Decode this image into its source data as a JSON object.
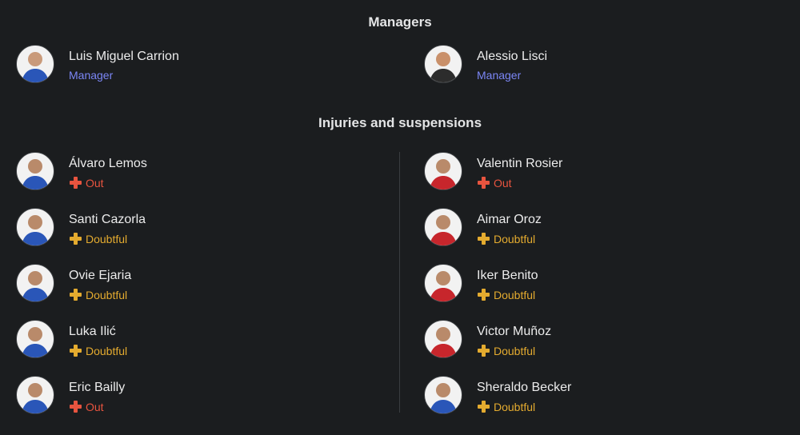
{
  "managers": {
    "title": "Managers",
    "items": [
      {
        "name": "Luis Miguel Carrion",
        "role": "Manager",
        "kit": "#2a56b8"
      },
      {
        "name": "Alessio Lisci",
        "role": "Manager",
        "kit": "#2c2c2c"
      }
    ]
  },
  "injuries": {
    "title": "Injuries and suspensions",
    "left": [
      {
        "name": "Álvaro Lemos",
        "status": "Out",
        "type": "out",
        "kit": "#2a56b8"
      },
      {
        "name": "Santi Cazorla",
        "status": "Doubtful",
        "type": "doubtful",
        "kit": "#2a56b8"
      },
      {
        "name": "Ovie Ejaria",
        "status": "Doubtful",
        "type": "doubtful",
        "kit": "#2a56b8"
      },
      {
        "name": "Luka Ilić",
        "status": "Doubtful",
        "type": "doubtful",
        "kit": "#2a56b8"
      },
      {
        "name": "Eric Bailly",
        "status": "Out",
        "type": "out",
        "kit": "#2a56b8"
      }
    ],
    "right": [
      {
        "name": "Valentin Rosier",
        "status": "Out",
        "type": "out",
        "kit": "#c7262c"
      },
      {
        "name": "Aimar Oroz",
        "status": "Doubtful",
        "type": "doubtful",
        "kit": "#c7262c"
      },
      {
        "name": "Iker Benito",
        "status": "Doubtful",
        "type": "doubtful",
        "kit": "#c7262c"
      },
      {
        "name": "Victor Muñoz",
        "status": "Doubtful",
        "type": "doubtful",
        "kit": "#c7262c"
      },
      {
        "name": "Sheraldo Becker",
        "status": "Doubtful",
        "type": "doubtful",
        "kit": "#2a56b8"
      }
    ]
  },
  "colors": {
    "background": "#1b1d1f",
    "role": "#7b86f5",
    "out": "#e8543f",
    "doubtful": "#e4ab2f"
  }
}
